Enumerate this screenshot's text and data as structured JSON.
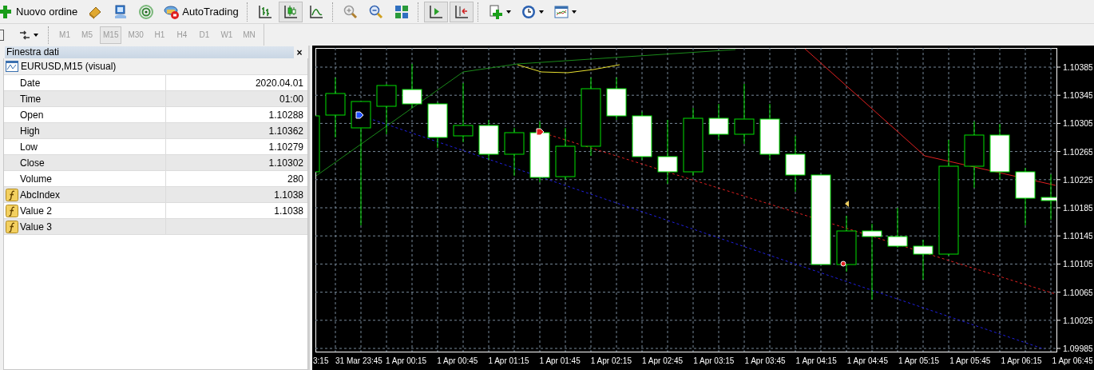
{
  "toolbar": [
    {
      "kind": "text-button",
      "label": "Nuovo ordine",
      "pressed": false
    },
    {
      "kind": "icon-button",
      "pressed": false
    },
    {
      "kind": "icon-button",
      "pressed": false
    },
    {
      "kind": "icon-button",
      "pressed": false
    },
    {
      "kind": "text-button",
      "label": "AutoTrading",
      "pressed": false
    },
    {
      "kind": "separator"
    },
    {
      "kind": "icon-button",
      "pressed": false
    },
    {
      "kind": "icon-button",
      "pressed": true
    },
    {
      "kind": "icon-button",
      "pressed": false
    },
    {
      "kind": "separator"
    },
    {
      "kind": "icon-button",
      "pressed": false
    },
    {
      "kind": "icon-button",
      "pressed": false
    },
    {
      "kind": "icon-button",
      "pressed": false
    },
    {
      "kind": "separator"
    },
    {
      "kind": "icon-button",
      "pressed": true
    },
    {
      "kind": "icon-button",
      "pressed": true
    },
    {
      "kind": "separator"
    },
    {
      "kind": "dropdown",
      "pressed": false
    },
    {
      "kind": "dropdown",
      "pressed": false
    },
    {
      "kind": "dropdown",
      "pressed": false
    }
  ],
  "timeframes": [
    {
      "label": "M1",
      "selected": false,
      "disabled": true
    },
    {
      "label": "M5",
      "selected": false,
      "disabled": true
    },
    {
      "label": "M15",
      "selected": true,
      "disabled": true
    },
    {
      "label": "M30",
      "selected": false,
      "disabled": true
    },
    {
      "label": "H1",
      "selected": false,
      "disabled": true
    },
    {
      "label": "H4",
      "selected": false,
      "disabled": true
    },
    {
      "label": "D1",
      "selected": false,
      "disabled": true
    },
    {
      "label": "W1",
      "selected": false,
      "disabled": true
    },
    {
      "label": "MN",
      "selected": false,
      "disabled": true
    }
  ],
  "data_window": {
    "title": "Finestra dati",
    "close": "×",
    "symbol": "EURUSD,M15 (visual)",
    "rows": [
      {
        "kind": "field",
        "label": "Date",
        "value": "2020.04.01"
      },
      {
        "kind": "field",
        "label": "Time",
        "value": "01:00"
      },
      {
        "kind": "field",
        "label": "Open",
        "value": "1.10288"
      },
      {
        "kind": "field",
        "label": "High",
        "value": "1.10362"
      },
      {
        "kind": "field",
        "label": "Low",
        "value": "1.10279"
      },
      {
        "kind": "field",
        "label": "Close",
        "value": "1.10302"
      },
      {
        "kind": "field",
        "label": "Volume",
        "value": "280"
      },
      {
        "kind": "indicator",
        "label": "AbcIndex",
        "value": "1.1038"
      },
      {
        "kind": "indicator",
        "label": "Value 2",
        "value": "1.1038"
      },
      {
        "kind": "indicator",
        "label": "Value 3"
      }
    ]
  },
  "chart": {
    "price_labels": [
      "1.10385",
      "1.10345",
      "1.10305",
      "1.10265",
      "1.10225",
      "1.10185",
      "1.10145",
      "1.10105",
      "1.10065",
      "1.10025",
      "1.09985"
    ],
    "time_labels": [
      "3:15",
      "31 Mar 23:45",
      "1 Apr 00:15",
      "1 Apr 00:45",
      "1 Apr 01:15",
      "1 Apr 01:45",
      "1 Apr 02:15",
      "1 Apr 02:45",
      "1 Apr 03:15",
      "1 Apr 03:45",
      "1 Apr 04:15",
      "1 Apr 04:45",
      "1 Apr 05:15",
      "1 Apr 05:45",
      "1 Apr 06:15",
      "1 Apr 06:45"
    ]
  }
}
